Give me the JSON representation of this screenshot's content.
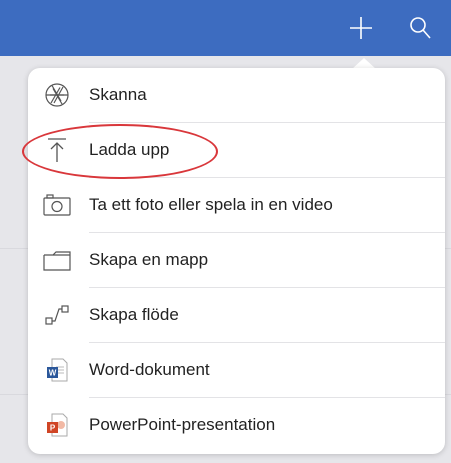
{
  "toolbar": {
    "add_icon": "plus-icon",
    "search_icon": "search-icon",
    "color": "#3d6cc0"
  },
  "menu": {
    "items": [
      {
        "label": "Skanna",
        "icon": "aperture-icon"
      },
      {
        "label": "Ladda upp",
        "icon": "upload-icon"
      },
      {
        "label": "Ta ett foto eller spela in en video",
        "icon": "camera-icon"
      },
      {
        "label": "Skapa en mapp",
        "icon": "folder-icon"
      },
      {
        "label": "Skapa flöde",
        "icon": "flow-icon"
      },
      {
        "label": "Word-dokument",
        "icon": "word-icon"
      },
      {
        "label": "PowerPoint-presentation",
        "icon": "powerpoint-icon"
      }
    ]
  },
  "highlight_color": "#d9373b"
}
